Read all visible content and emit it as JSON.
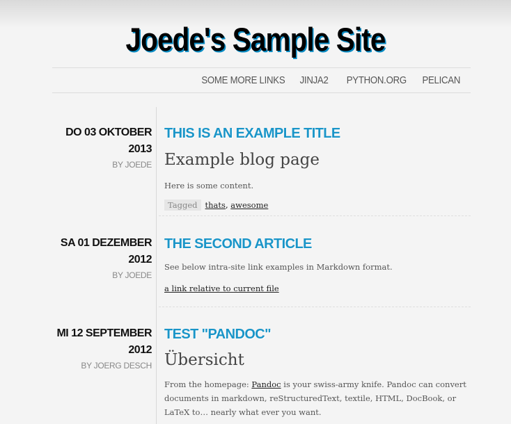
{
  "site": {
    "title": "Joede's Sample Site"
  },
  "nav": [
    {
      "label": "Some More Links"
    },
    {
      "label": "Jinja2"
    },
    {
      "label": "Python.org"
    },
    {
      "label": "Pelican"
    }
  ],
  "articles": [
    {
      "date": "Do 03 Oktober 2013",
      "author": "By Joede",
      "title": "This is an example title",
      "heading": "Example blog page",
      "content": "Here is some content.",
      "tags_label": "Tagged",
      "tags": [
        "thats",
        "awesome"
      ]
    },
    {
      "date": "Sa 01 Dezember 2012",
      "author": "By Joede",
      "title": "The second article",
      "content": "See below intra-site link examples in Markdown format.",
      "link": "a link relative to current file"
    },
    {
      "date_line1": "Mi 12 September",
      "date_line2": "2012",
      "author": "By Joerg Desch",
      "title": "Test \"pandoc\"",
      "heading": "Übersicht",
      "content_prefix": "From the homepage: ",
      "content_link": "Pandoc",
      "content_suffix": " is your swiss-army knife. Pandoc can convert documents in markdown, reStructuredText, textile, HTML, DocBook, or LaTeX to… nearly what ever you want."
    }
  ]
}
